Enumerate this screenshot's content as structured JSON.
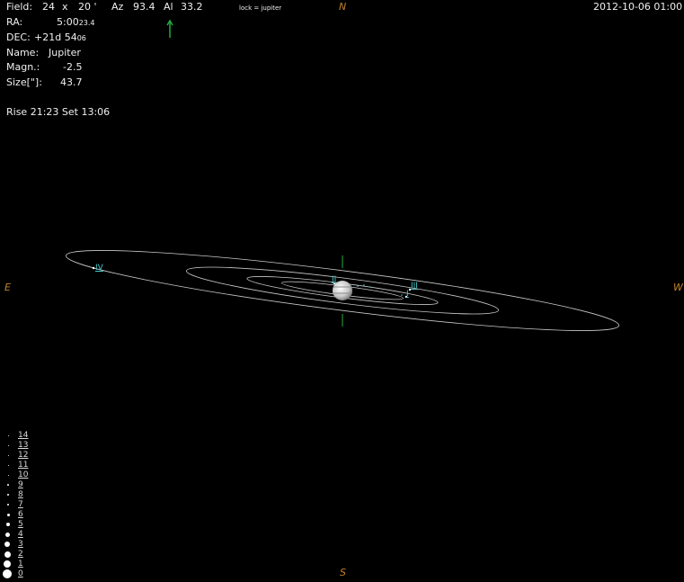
{
  "header": {
    "field_label": "Field:",
    "field_w": "24",
    "field_x": "x",
    "field_h": "20 '",
    "az_label": "Az",
    "az_value": "93.4",
    "alt_label": "Al",
    "alt_value": "33.2",
    "lock_text": "lock = jupiter",
    "datetime": "2012-10-06  01:00"
  },
  "info": {
    "ra_label": "RA:",
    "ra_main": "5:00",
    "ra_sub": "23.4",
    "dec_label": "DEC:",
    "dec_main": "+21d 54",
    "dec_sub": "06",
    "name_label": "Name:",
    "name_value": "Jupiter",
    "magn_label": "Magn.:",
    "magn_value": "-2.5",
    "size_label": "Size[\"]:",
    "size_value": "43.7",
    "rise_set": "Rise 21:23  Set 13:06"
  },
  "compass": {
    "n": "N",
    "s": "S",
    "e": "E",
    "w": "W"
  },
  "moons": {
    "i": "I",
    "ii": "II",
    "iii": "III",
    "iv": "IV"
  },
  "magnitude_scale": [
    "14",
    "13",
    "12",
    "11",
    "10",
    "9",
    "8",
    "7",
    "6",
    "5",
    "4",
    "3",
    "2",
    "1",
    "0"
  ],
  "colors": {
    "text": "#f0f0f0",
    "compass": "#c0822a",
    "moon_label": "#48c8c8",
    "crosshair": "#1fae3e",
    "orbit": "#c8c8c8"
  },
  "icons": {
    "direction_arrow": "green-up-arrow-icon",
    "planet": "jupiter-disk-icon"
  }
}
